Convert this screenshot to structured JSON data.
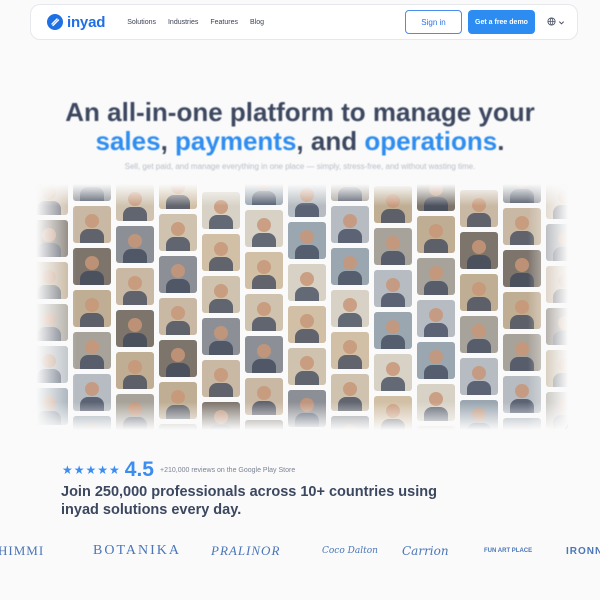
{
  "nav": {
    "logo_text": "inyad",
    "menu": [
      "Solutions",
      "Industries",
      "Features",
      "Blog"
    ],
    "signin_label": "Sign in",
    "demo_label": "Get a free demo",
    "globe_icon": "globe-icon",
    "chevron_icon": "chevron-down-icon"
  },
  "hero": {
    "line1": "An all-in-one platform to manage your",
    "word_sales": "sales",
    "comma1": ", ",
    "word_payments": "payments",
    "and_text": ", and ",
    "word_operations": "operations",
    "period": ".",
    "subtitle": "Sell, get paid, and manage everything in one place — simply, stress-free, and without wasting time."
  },
  "rating": {
    "stars": "★★★★★",
    "star_count": 5,
    "score": "4.5",
    "reviews_text": "+210,000 reviews on the Google Play Store"
  },
  "join_text": "Join 250,000 professionals across 10+ countries using inyad solutions every day.",
  "brands": [
    "HIMMI",
    "BOTANIKA",
    "PRALINOR",
    "Coco Dalton",
    "Carrion",
    "FUN ART PLACE",
    "IRONN"
  ],
  "colors": {
    "brand_blue": "#1f6fe5",
    "accent_blue": "#2e8df0",
    "heading": "#3c4760"
  }
}
